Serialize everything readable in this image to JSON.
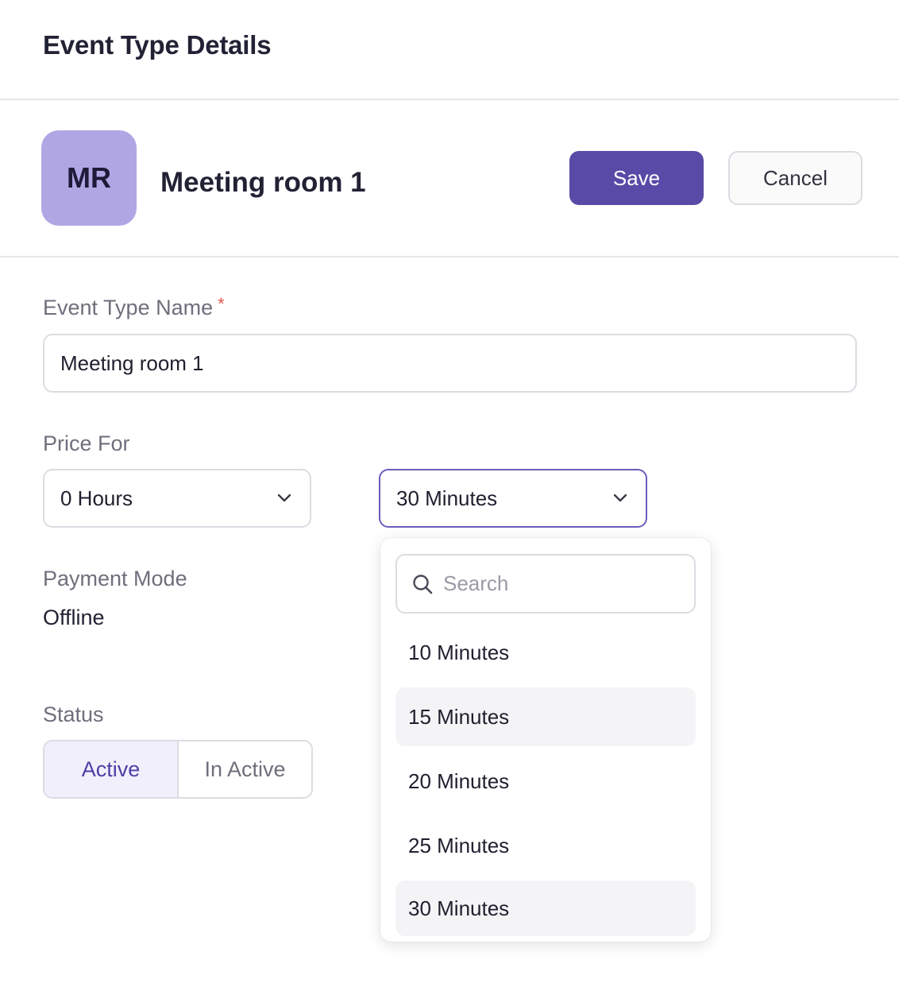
{
  "header": {
    "title": "Event Type Details"
  },
  "entity": {
    "avatar_initials": "MR",
    "avatar_color": "#b1a6e4",
    "name": "Meeting room 1"
  },
  "actions": {
    "save_label": "Save",
    "cancel_label": "Cancel",
    "save_color": "#584aa6"
  },
  "form": {
    "event_type_name": {
      "label": "Event Type Name",
      "required_mark": "*",
      "value": "Meeting room 1"
    },
    "price_for": {
      "label": "Price For",
      "hours_value": "0 Hours",
      "minutes_value": "30 Minutes",
      "chevron_icon": "chevron-down-icon"
    },
    "payment_mode": {
      "label": "Payment Mode",
      "value": "Offline"
    },
    "status": {
      "label": "Status",
      "options": [
        "Active",
        "In Active"
      ],
      "selected": "Active"
    }
  },
  "minutes_dropdown": {
    "search_placeholder": "Search",
    "search_icon": "search-icon",
    "options": [
      "10 Minutes",
      "15 Minutes",
      "20 Minutes",
      "25 Minutes",
      "30 Minutes"
    ],
    "hovered": "15 Minutes",
    "selected": "30 Minutes"
  }
}
